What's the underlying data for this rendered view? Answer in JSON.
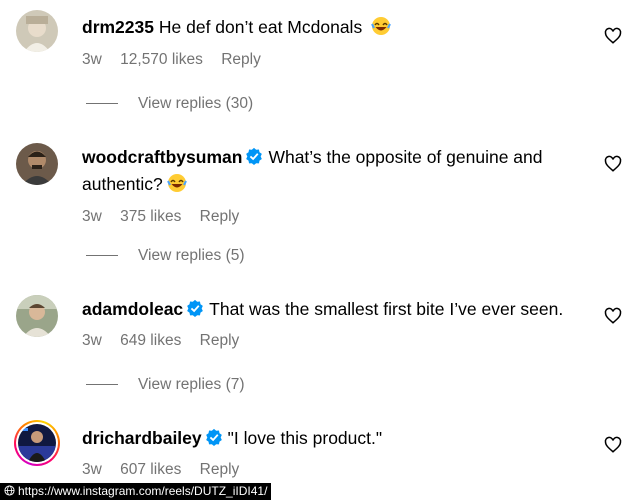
{
  "comments": [
    {
      "username": "drm2235",
      "verified": false,
      "text": "He def don’t eat Mcdonals",
      "emoji": "laughing-face",
      "age": "3w",
      "likes": "12,570 likes",
      "reply": "Reply",
      "view_replies": "View replies (30)"
    },
    {
      "username": "woodcraftbysuman",
      "verified": true,
      "text": "What’s the opposite of genuine and",
      "text_line2": "authentic?",
      "emoji": "laughing-face",
      "age": "3w",
      "likes": "375 likes",
      "reply": "Reply",
      "view_replies": "View replies (5)"
    },
    {
      "username": "adamdoleac",
      "verified": true,
      "text": "That was the smallest first bite I’ve ever seen.",
      "age": "3w",
      "likes": "649 likes",
      "reply": "Reply",
      "view_replies": "View replies (7)"
    },
    {
      "username": "drichardbailey",
      "verified": true,
      "text": "\"I love this product.\"",
      "age": "3w",
      "likes": "607 likes",
      "reply": "Reply",
      "story_ring": true
    }
  ],
  "source_url": "https://www.instagram.com/reels/DUTZ_iIDI41/",
  "colors": {
    "verified_blue": "#0095f6",
    "secondary_text": "#737373",
    "url_bar_bg": "#000000"
  }
}
